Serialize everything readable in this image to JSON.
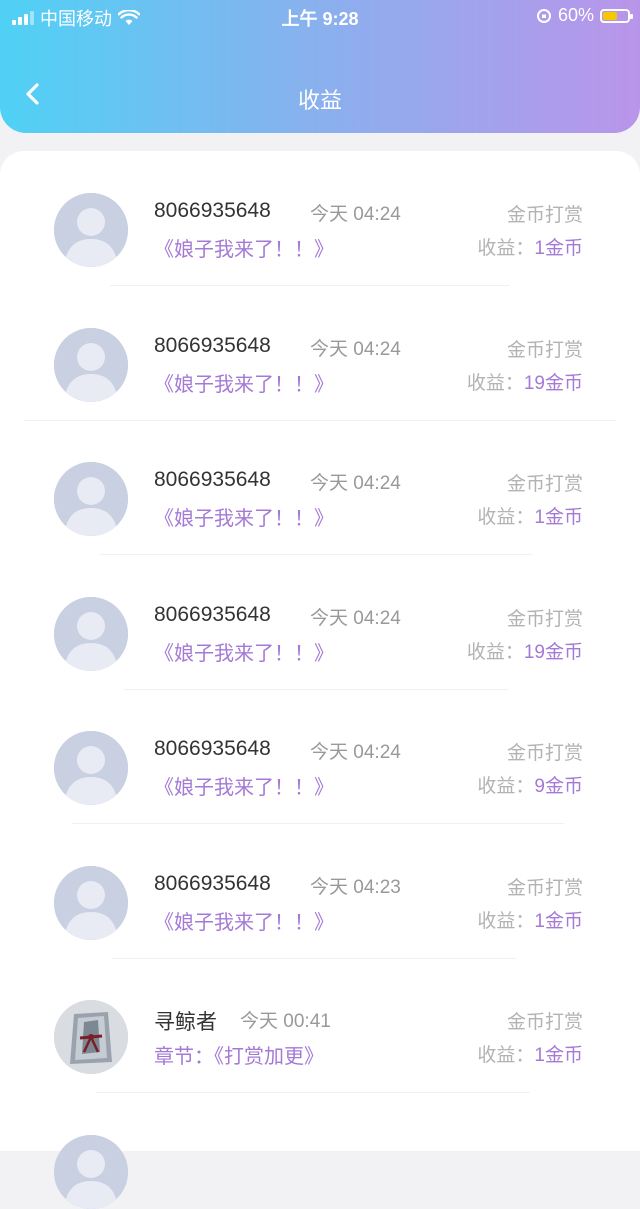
{
  "status_bar": {
    "carrier": "中国移动",
    "time": "上午 9:28",
    "battery": "60%",
    "battery_level": 0.6
  },
  "nav": {
    "title": "收益"
  },
  "records": [
    {
      "name": "8066935648",
      "time": "今天 04:24",
      "book": "《娘子我来了！！》",
      "type": "金币打赏",
      "earn_label": "收益：",
      "earn_value": "1金币",
      "avatar": "default-avatar"
    },
    {
      "name": "8066935648",
      "time": "今天 04:24",
      "book": "《娘子我来了！！》",
      "type": "金币打赏",
      "earn_label": "收益：",
      "earn_value": "19金币",
      "avatar": "default-avatar"
    },
    {
      "name": "8066935648",
      "time": "今天 04:24",
      "book": "《娘子我来了！！》",
      "type": "金币打赏",
      "earn_label": "收益：",
      "earn_value": "1金币",
      "avatar": "default-avatar"
    },
    {
      "name": "8066935648",
      "time": "今天 04:24",
      "book": "《娘子我来了！！》",
      "type": "金币打赏",
      "earn_label": "收益：",
      "earn_value": "19金币",
      "avatar": "default-avatar"
    },
    {
      "name": "8066935648",
      "time": "今天 04:24",
      "book": "《娘子我来了！！》",
      "type": "金币打赏",
      "earn_label": "收益：",
      "earn_value": "9金币",
      "avatar": "default-avatar"
    },
    {
      "name": "8066935648",
      "time": "今天 04:23",
      "book": "《娘子我来了！！》",
      "type": "金币打赏",
      "earn_label": "收益：",
      "earn_value": "1金币",
      "avatar": "default-avatar"
    },
    {
      "name": "寻鲸者",
      "time": "今天 00:41",
      "book": "章节：《打赏加更》",
      "type": "金币打赏",
      "earn_label": "收益：",
      "earn_value": "1金币",
      "avatar": "photo-avatar"
    }
  ]
}
